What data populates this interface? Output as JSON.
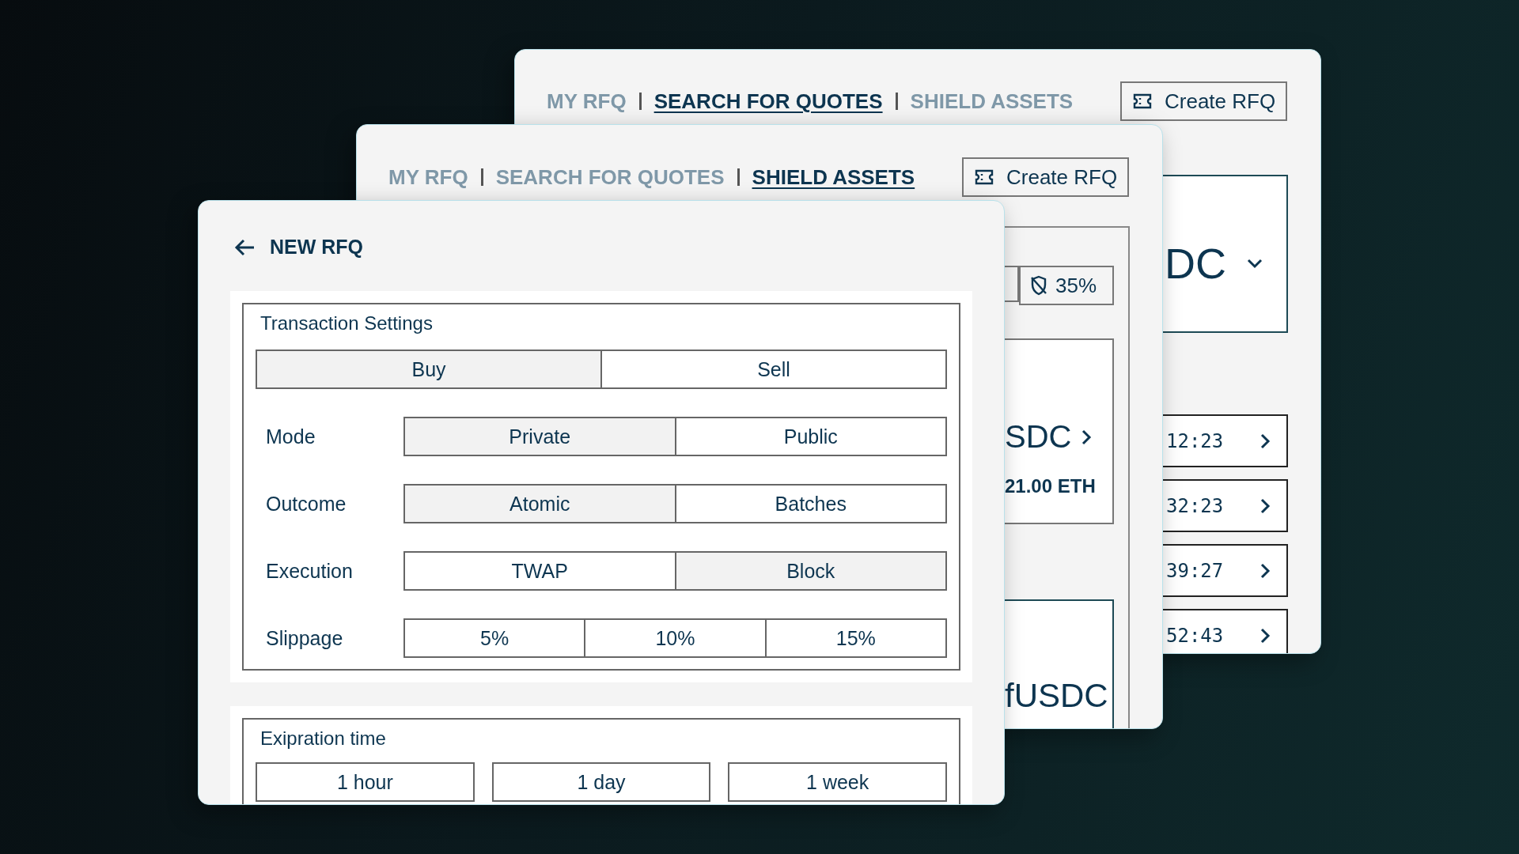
{
  "windows": [
    {
      "kind": "quotes",
      "tabs": [
        {
          "label": "MY RFQ",
          "selected": false
        },
        {
          "label": "SEARCH FOR QUOTES",
          "selected": true
        },
        {
          "label": "SHIELD ASSETS",
          "selected": false
        }
      ],
      "create_button": {
        "label": "Create RFQ"
      },
      "token_select": {
        "label": "DC"
      },
      "quote_rows": [
        {
          "time": "12:23"
        },
        {
          "time": "32:23"
        },
        {
          "time": "39:27"
        },
        {
          "time": "52:43"
        }
      ]
    },
    {
      "kind": "shield",
      "tabs": [
        {
          "label": "MY RFQ",
          "selected": false
        },
        {
          "label": "SEARCH FOR QUOTES",
          "selected": false
        },
        {
          "label": "SHIELD ASSETS",
          "selected": true
        }
      ],
      "create_button": {
        "label": "Create RFQ"
      },
      "shield_badge": {
        "label": "35%"
      },
      "quote_card": {
        "pair": "SDC",
        "amount": "21.00 ETH"
      },
      "asset_card": {
        "label": "fUSDC"
      }
    },
    {
      "kind": "new_rfq",
      "title": "NEW RFQ",
      "transaction_settings": {
        "title": "Transaction Settings",
        "side": [
          {
            "label": "Buy",
            "selected": true
          },
          {
            "label": "Sell",
            "selected": false
          }
        ],
        "rows": [
          {
            "label": "Mode",
            "options": [
              {
                "label": "Private",
                "selected": true
              },
              {
                "label": "Public",
                "selected": false
              }
            ]
          },
          {
            "label": "Outcome",
            "options": [
              {
                "label": "Atomic",
                "selected": true
              },
              {
                "label": "Batches",
                "selected": false
              }
            ]
          },
          {
            "label": "Execution",
            "options": [
              {
                "label": "TWAP",
                "selected": false
              },
              {
                "label": "Block",
                "selected": true
              }
            ]
          },
          {
            "label": "Slippage",
            "options": [
              {
                "label": "5%",
                "selected": false
              },
              {
                "label": "10%",
                "selected": false
              },
              {
                "label": "15%",
                "selected": false
              }
            ]
          }
        ]
      },
      "expiration": {
        "title": "Exipration time",
        "options": [
          {
            "label": "1 hour",
            "selected": false
          },
          {
            "label": "1 day",
            "selected": false
          },
          {
            "label": "1 week",
            "selected": false
          }
        ]
      }
    }
  ]
}
